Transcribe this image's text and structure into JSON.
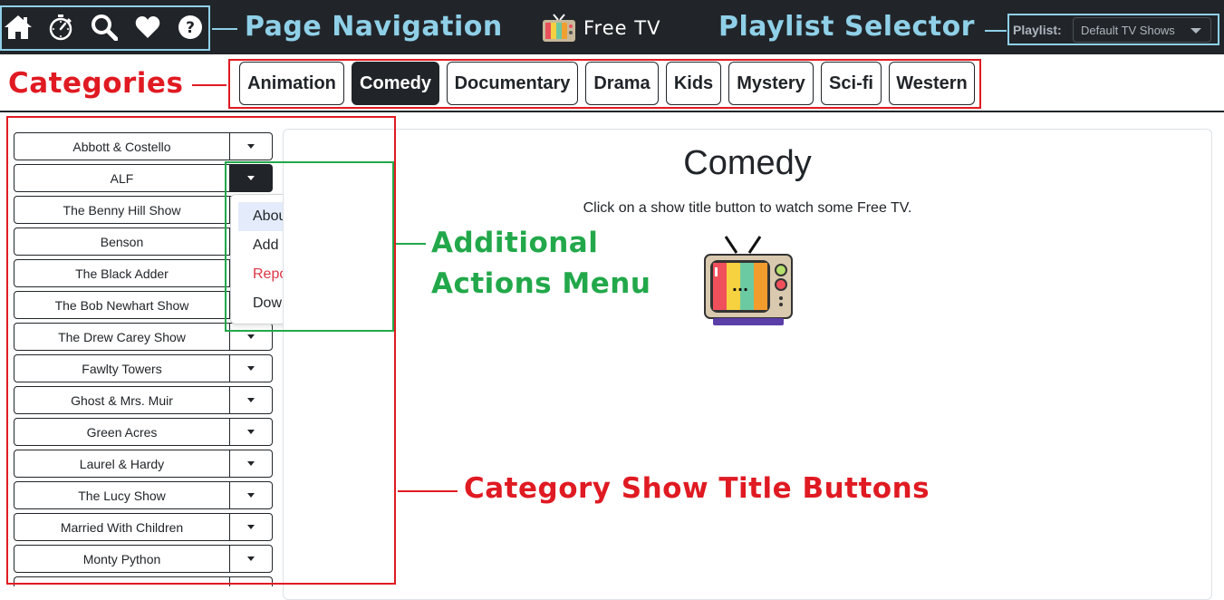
{
  "nav": {
    "icons": [
      "home-icon",
      "stopwatch-icon",
      "search-icon",
      "heart-icon",
      "help-icon"
    ]
  },
  "brand": {
    "title": "Free TV"
  },
  "playlist": {
    "label": "Playlist:",
    "selected": "Default TV Shows"
  },
  "categories": [
    "Animation",
    "Comedy",
    "Documentary",
    "Drama",
    "Kids",
    "Mystery",
    "Sci-fi",
    "Western"
  ],
  "active_category": "Comedy",
  "shows": [
    "Abbott & Costello",
    "ALF",
    "The Benny Hill Show",
    "Benson",
    "The Black Adder",
    "The Bob Newhart Show",
    "The Drew Carey Show",
    "Fawlty Towers",
    "Ghost & Mrs. Muir",
    "Green Acres",
    "Laurel & Hardy",
    "The Lucy Show",
    "Married With Children",
    "Monty Python"
  ],
  "open_menu_show": "ALF",
  "menu": {
    "about": "About this show",
    "favorites": "Add to favorites",
    "report": "Report a problem",
    "download": "Download files"
  },
  "content": {
    "title": "Comedy",
    "subtitle": "Click on a show title button to watch some Free TV."
  },
  "annotations": {
    "page_navigation": "Page Navigation",
    "playlist_selector": "Playlist Selector",
    "categories": "Categories",
    "additional_actions_1": "Additional",
    "additional_actions_2": "Actions Menu",
    "category_show_buttons": "Category Show Title Buttons"
  },
  "colors": {
    "navbar": "#212529",
    "annotation_blue": "#8fd0e8",
    "annotation_red": "#e01a22",
    "annotation_green": "#22a84a",
    "danger": "#dc3545"
  }
}
